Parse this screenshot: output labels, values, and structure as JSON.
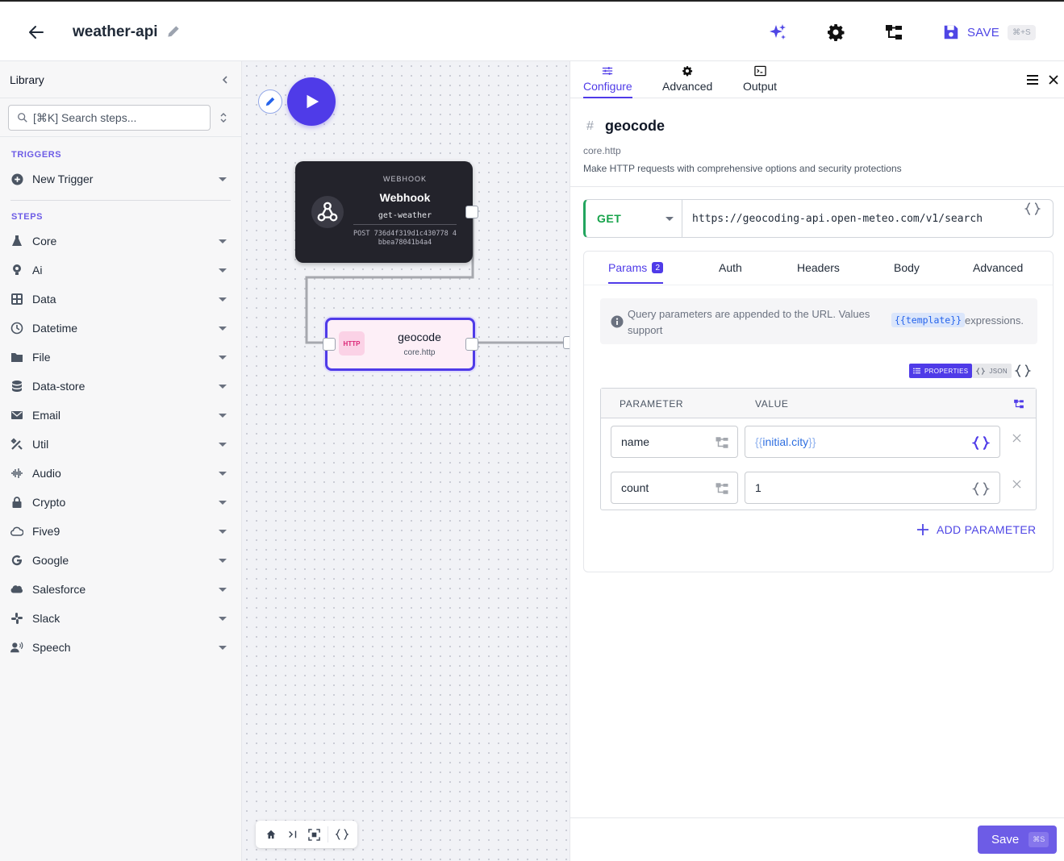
{
  "topbar": {
    "title": "weather-api",
    "save_label": "SAVE",
    "save_shortcut": "⌘+S",
    "icons": [
      "back-arrow-icon",
      "pencil-icon",
      "sparkles-icon",
      "gear-icon",
      "tree-icon",
      "floppy-disk-icon"
    ],
    "accent_color": "#4f46e5"
  },
  "library": {
    "title": "Library",
    "search_placeholder": "[⌘K] Search steps...",
    "triggers_label": "TRIGGERS",
    "new_trigger": "New Trigger",
    "steps_label": "STEPS",
    "steps": [
      {
        "label": "Core",
        "icon": "flask-icon"
      },
      {
        "label": "Ai",
        "icon": "bulb-icon"
      },
      {
        "label": "Data",
        "icon": "table-icon"
      },
      {
        "label": "Datetime",
        "icon": "clock-icon"
      },
      {
        "label": "File",
        "icon": "folder-icon"
      },
      {
        "label": "Data-store",
        "icon": "database-icon"
      },
      {
        "label": "Email",
        "icon": "envelope-icon"
      },
      {
        "label": "Util",
        "icon": "tools-icon"
      },
      {
        "label": "Audio",
        "icon": "waveform-icon"
      },
      {
        "label": "Crypto",
        "icon": "lock-icon"
      },
      {
        "label": "Five9",
        "icon": "cloud-icon"
      },
      {
        "label": "Google",
        "icon": "google-icon"
      },
      {
        "label": "Salesforce",
        "icon": "salesforce-cloud-icon"
      },
      {
        "label": "Slack",
        "icon": "slack-icon"
      },
      {
        "label": "Speech",
        "icon": "speaker-person-icon"
      }
    ]
  },
  "canvas": {
    "webhook_node": {
      "kind": "WEBHOOK",
      "name": "Webhook",
      "slug": "get-weather",
      "url": "POST 736d4f319d1c430778 4bbea78041b4a4"
    },
    "http_node": {
      "badge": "HTTP",
      "name": "geocode",
      "type": "core.http"
    }
  },
  "panel": {
    "tabs": [
      {
        "label": "Configure",
        "icon": "sliders-icon"
      },
      {
        "label": "Advanced",
        "icon": "gear-icon"
      },
      {
        "label": "Output",
        "icon": "terminal-icon"
      }
    ],
    "active_tab": "Configure",
    "step": {
      "hash": "#",
      "name": "geocode",
      "type": "core.http",
      "description": "Make HTTP requests with comprehensive options and security protections"
    },
    "request": {
      "method": "GET",
      "url": "https://geocoding-api.open-meteo.com/v1/search",
      "method_color": "#16a34a"
    },
    "sub_tabs": [
      {
        "label": "Params",
        "badge": "2"
      },
      {
        "label": "Auth"
      },
      {
        "label": "Headers"
      },
      {
        "label": "Body"
      },
      {
        "label": "Advanced"
      }
    ],
    "info": {
      "text": "Query parameters are appended to the URL. Values support",
      "template_chip": "{{template}}",
      "tail": "expressions."
    },
    "mode": {
      "properties": "PROPERTIES",
      "json": "JSON"
    },
    "table": {
      "col_param": "PARAMETER",
      "col_value": "VALUE",
      "rows": [
        {
          "name": "name",
          "value_open": "{{",
          "value_inner": "initial.city",
          "value_close": "}}"
        },
        {
          "name": "count",
          "value": "1"
        }
      ]
    },
    "add_param_label": "ADD PARAMETER",
    "save_label": "Save",
    "save_shortcut": "⌘S"
  }
}
